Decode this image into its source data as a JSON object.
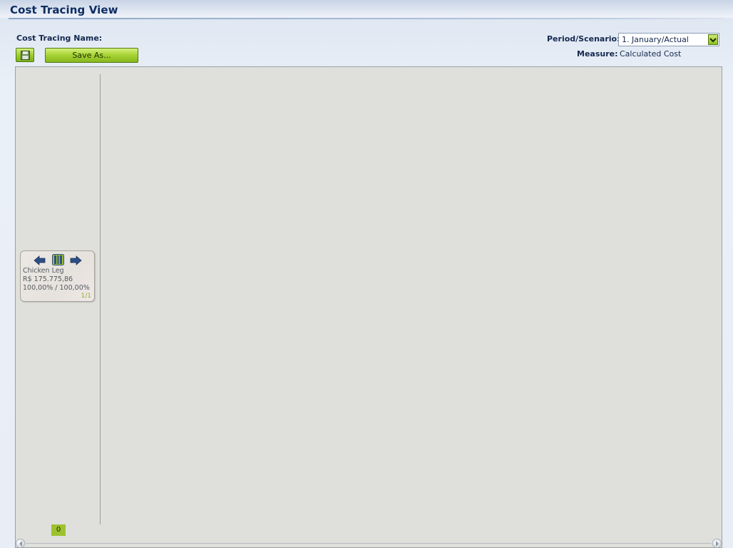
{
  "page": {
    "title": "Cost Tracing View"
  },
  "form": {
    "cost_tracing_name_label": "Cost Tracing Name:",
    "save_as_label": "Save As...",
    "save_icon": "floppy-disk-icon",
    "period_label": "Period/Scenario:",
    "period_value": "1. January/Actual",
    "measure_label": "Measure:",
    "measure_value": "Calculated Cost"
  },
  "node": {
    "name": "Chicken Leg",
    "amount": "R$ 175.775,86",
    "percent": "100,00% / 100,00%",
    "count": "1/1",
    "icons": [
      "arrow-left-icon",
      "columns-icon",
      "arrow-right-icon"
    ]
  },
  "level_badge": "0",
  "colors": {
    "title": "#0f2d63",
    "accent_green": "#9dc22f",
    "canvas_bg": "#dfe0db"
  }
}
